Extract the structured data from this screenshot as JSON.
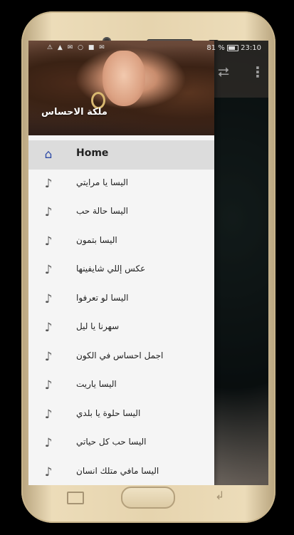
{
  "status_bar": {
    "signal_icons": "⚠ ▲ ✉ ○ ■ ✉",
    "battery_percent": "81 %",
    "time": "23:10"
  },
  "toolbar": {
    "share_icon": "share-icon",
    "more_icon": "more-vert-icon"
  },
  "drawer": {
    "title": "ملكة الاحساس",
    "items": [
      {
        "label": "Home",
        "icon": "home-icon",
        "active": true
      },
      {
        "label": "اليسا يا مرايتي",
        "icon": "music-note-icon"
      },
      {
        "label": "اليسا حالة حب",
        "icon": "music-note-icon"
      },
      {
        "label": "اليسا بتمون",
        "icon": "music-note-icon"
      },
      {
        "label": "عكس إللي شايفينها",
        "icon": "music-note-icon"
      },
      {
        "label": "اليسا لو تعرفوا",
        "icon": "music-note-icon"
      },
      {
        "label": "سهرنا يا ليل",
        "icon": "music-note-icon"
      },
      {
        "label": "اجمل احساس في الكون",
        "icon": "music-note-icon"
      },
      {
        "label": "اليسا ياريت",
        "icon": "music-note-icon"
      },
      {
        "label": "اليسا حلوة يا بلدي",
        "icon": "music-note-icon"
      },
      {
        "label": "اليسا حب كل حياتي",
        "icon": "music-note-icon"
      },
      {
        "label": "اليسا مافي متلك انسان",
        "icon": "music-note-icon"
      }
    ]
  },
  "colors": {
    "active_icon": "#2d4aa6",
    "drawer_bg": "#f5f5f5",
    "active_row": "#dcdcdc"
  }
}
